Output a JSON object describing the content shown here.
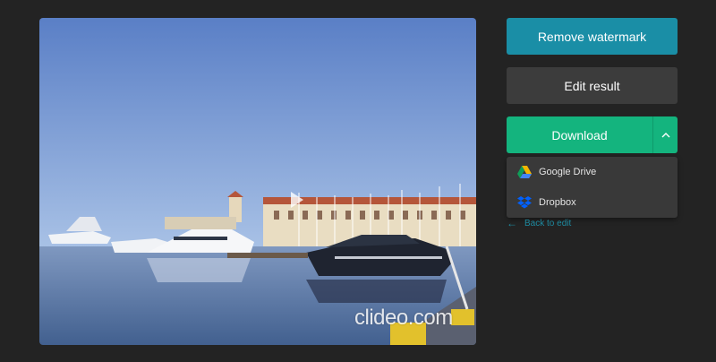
{
  "preview": {
    "watermark_text": "clideo.com",
    "play_icon": "play-icon"
  },
  "actions": {
    "remove_watermark_label": "Remove watermark",
    "edit_result_label": "Edit result",
    "download_label": "Download",
    "download_toggle_icon": "chevron-up-icon"
  },
  "download_menu": {
    "items": [
      {
        "label": "Google Drive",
        "icon": "google-drive-icon"
      },
      {
        "label": "Dropbox",
        "icon": "dropbox-icon"
      }
    ]
  },
  "back_link": {
    "label": "Back to edit",
    "icon": "arrow-left-icon"
  },
  "colors": {
    "background": "#232323",
    "remove_watermark": "#1a8ea6",
    "edit_result": "#3c3c3c",
    "download": "#14b47e",
    "dropdown": "#393939",
    "link": "#1e8aa0"
  }
}
